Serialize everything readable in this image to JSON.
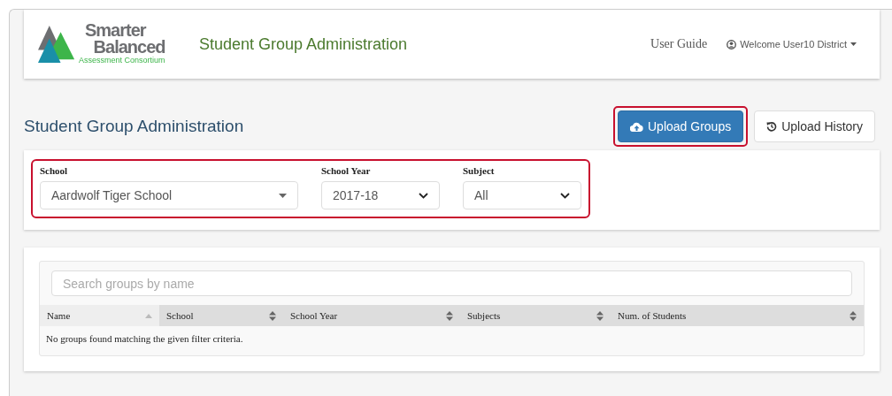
{
  "header": {
    "logo": {
      "line_1": "Smarter",
      "line_2": "Balanced",
      "tagline": "Assessment Consortium"
    },
    "app_title": "Student Group Administration",
    "links": [
      {
        "kind": "link",
        "label": "User Guide"
      },
      {
        "kind": "user-menu",
        "label": "Welcome User10 District"
      }
    ]
  },
  "page_title": "Student Group Administration",
  "actions": [
    {
      "kind": "primary",
      "label": "Upload Groups",
      "highlighted": true
    },
    {
      "kind": "default",
      "label": "Upload History",
      "highlighted": false
    }
  ],
  "filters": {
    "highlighted": true,
    "fields": [
      {
        "kind": "wide",
        "label": "School",
        "value": "Aardwolf Tiger School"
      },
      {
        "kind": "narrow",
        "label": "School Year",
        "value": "2017-18"
      },
      {
        "kind": "narrow",
        "label": "Subject",
        "value": "All"
      }
    ]
  },
  "table": {
    "search": {
      "placeholder": "Search groups by name"
    },
    "columns": [
      {
        "label": "Name",
        "selected": true
      },
      {
        "label": "School",
        "selected": false
      },
      {
        "label": "School Year",
        "selected": false
      },
      {
        "label": "Subjects",
        "selected": false
      },
      {
        "label": "Num. of Students",
        "selected": false
      }
    ],
    "empty_message": "No groups found matching the given filter criteria."
  }
}
